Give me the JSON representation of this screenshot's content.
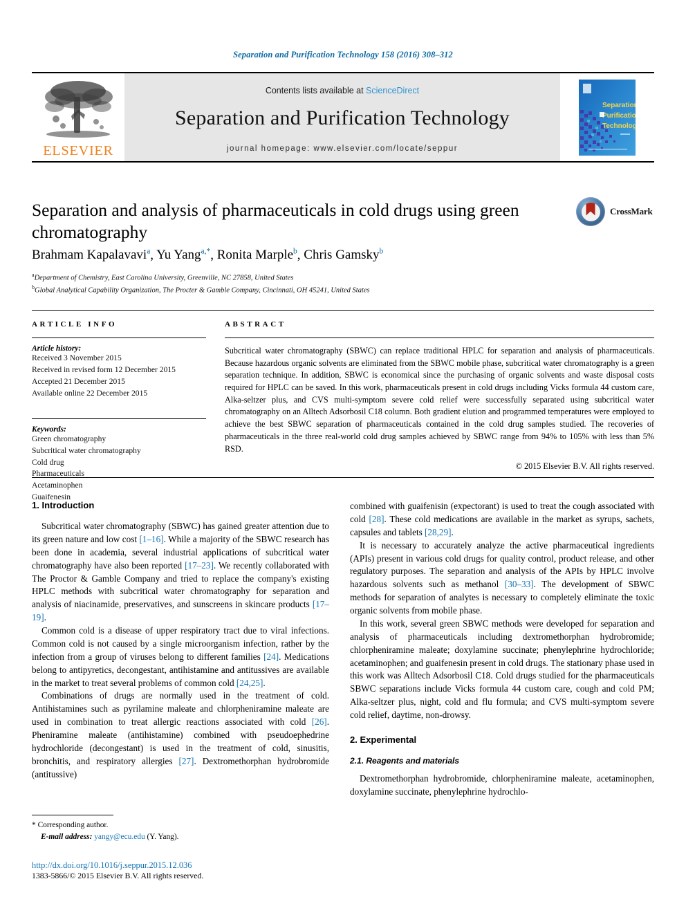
{
  "running_head": "Separation and Purification Technology 158 (2016) 308–312",
  "masthead": {
    "publisher_name": "ELSEVIER",
    "contents_prefix": "Contents lists available at ",
    "sciencedirect": "ScienceDirect",
    "journal_title": "Separation and Purification Technology",
    "homepage": "journal homepage: www.elsevier.com/locate/seppur",
    "cover": {
      "line1": "Separation",
      "line2": "Purification",
      "line3": "Technology",
      "amp": "and"
    }
  },
  "article": {
    "title": "Separation and analysis of pharmaceuticals in cold drugs using green chromatography",
    "authors": [
      {
        "name": "Brahmam Kapalavavi",
        "marks": "a"
      },
      {
        "name": "Yu Yang",
        "marks": "a,*"
      },
      {
        "name": "Ronita Marple",
        "marks": "b"
      },
      {
        "name": "Chris Gamsky",
        "marks": "b"
      }
    ],
    "affiliations": [
      {
        "mark": "a",
        "text": "Department of Chemistry, East Carolina University, Greenville, NC 27858, United States"
      },
      {
        "mark": "b",
        "text": "Global Analytical Capability Organization, The Procter & Gamble Company, Cincinnati, OH 45241, United States"
      }
    ],
    "crossmark_label": "CrossMark"
  },
  "info": {
    "heading": "ARTICLE INFO",
    "history_label": "Article history:",
    "history": [
      "Received 3 November 2015",
      "Received in revised form 12 December 2015",
      "Accepted 21 December 2015",
      "Available online 22 December 2015"
    ],
    "keywords_label": "Keywords:",
    "keywords": [
      "Green chromatography",
      "Subcritical water chromatography",
      "Cold drug",
      "Pharmaceuticals",
      "Acetaminophen",
      "Guaifenesin"
    ]
  },
  "abstract": {
    "heading": "ABSTRACT",
    "text": "Subcritical water chromatography (SBWC) can replace traditional HPLC for separation and analysis of pharmaceuticals. Because hazardous organic solvents are eliminated from the SBWC mobile phase, subcritical water chromatography is a green separation technique. In addition, SBWC is economical since the purchasing of organic solvents and waste disposal costs required for HPLC can be saved. In this work, pharmaceuticals present in cold drugs including Vicks formula 44 custom care, Alka-seltzer plus, and CVS multi-symptom severe cold relief were successfully separated using subcritical water chromatography on an Alltech Adsorbosil C18 column. Both gradient elution and programmed temperatures were employed to achieve the best SBWC separation of pharmaceuticals contained in the cold drug samples studied. The recoveries of pharmaceuticals in the three real-world cold drug samples achieved by SBWC range from 94% to 105% with less than 5% RSD.",
    "copyright": "© 2015 Elsevier B.V. All rights reserved."
  },
  "body": {
    "left": {
      "section_heading": "1. Introduction",
      "paragraphs": [
        "Subcritical water chromatography (SBWC) has gained greater attention due to its green nature and low cost [1–16]. While a majority of the SBWC research has been done in academia, several industrial applications of subcritical water chromatography have also been reported [17–23]. We recently collaborated with The Proctor & Gamble Company and tried to replace the company's existing HPLC methods with subcritical water chromatography for separation and analysis of niacinamide, preservatives, and sunscreens in skincare products [17–19].",
        "Common cold is a disease of upper respiratory tract due to viral infections. Common cold is not caused by a single microorganism infection, rather by the infection from a group of viruses belong to different families [24]. Medications belong to antipyretics, decongestant, antihistamine and antitussives are available in the market to treat several problems of common cold [24,25].",
        "Combinations of drugs are normally used in the treatment of cold. Antihistamines such as pyrilamine maleate and chlorpheniramine maleate are used in combination to treat allergic reactions associated with cold [26]. Pheniramine maleate (antihistamine) combined with pseudoephedrine hydrochloride (decongestant) is used in the treatment of cold, sinusitis, bronchitis, and respiratory allergies [27]. Dextromethorphan hydrobromide (antitussive)"
      ]
    },
    "right": {
      "paragraphs": [
        "combined with guaifenisin (expectorant) is used to treat the cough associated with cold [28]. These cold medications are available in the market as syrups, sachets, capsules and tablets [28,29].",
        "It is necessary to accurately analyze the active pharmaceutical ingredients (APIs) present in various cold drugs for quality control, product release, and other regulatory purposes. The separation and analysis of the APIs by HPLC involve hazardous solvents such as methanol [30–33]. The development of SBWC methods for separation of analytes is necessary to completely eliminate the toxic organic solvents from mobile phase.",
        "In this work, several green SBWC methods were developed for separation and analysis of pharmaceuticals including dextromethorphan hydrobromide; chlorpheniramine maleate; doxylamine succinate; phenylephrine hydrochloride; acetaminophen; and guaifenesin present in cold drugs. The stationary phase used in this work was Alltech Adsorbosil C18. Cold drugs studied for the pharmaceuticals SBWC separations include Vicks formula 44 custom care, cough and cold PM; Alka-seltzer plus, night, cold and flu formula; and CVS multi-symptom severe cold relief, daytime, non-drowsy."
      ],
      "section_heading": "2. Experimental",
      "subsection_heading": "2.1. Reagents and materials",
      "last_paragraph": "Dextromethorphan hydrobromide, chlorpheniramine maleate, acetaminophen, doxylamine succinate, phenylephrine hydrochlo-"
    }
  },
  "footnote": {
    "corresponding_mark": "*",
    "corresponding_text": "Corresponding author.",
    "email_label": "E-mail address:",
    "email": "yangy@ecu.edu",
    "email_owner": "(Y. Yang)."
  },
  "doi": {
    "url": "http://dx.doi.org/10.1016/j.seppur.2015.12.036",
    "issn_line": "1383-5866/© 2015 Elsevier B.V. All rights reserved."
  },
  "colors": {
    "link_blue": "#1273b5",
    "sciencedirect_blue": "#2e93d1",
    "elsevier_orange": "#f08322",
    "band_gray": "#e6e6e6"
  }
}
